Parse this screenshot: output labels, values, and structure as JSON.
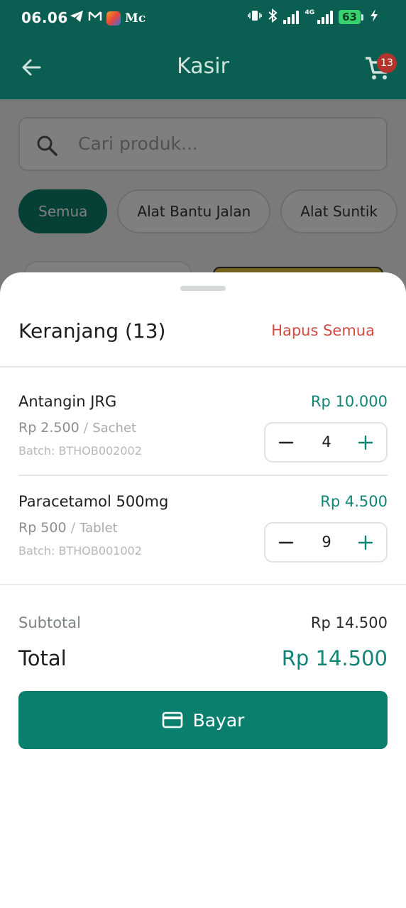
{
  "status_bar": {
    "time": "06.06",
    "notification_text": "Mc",
    "network_type": "4G",
    "battery": "63",
    "icons": [
      "telegram-icon",
      "gmail-icon",
      "app-icon",
      "vibrate-icon",
      "bluetooth-icon",
      "signal-icon",
      "charging-icon"
    ]
  },
  "app_bar": {
    "title": "Kasir",
    "cart_badge": "13"
  },
  "background": {
    "search_placeholder": "Cari produk...",
    "categories": [
      "Semua",
      "Alat Bantu Jalan",
      "Alat Suntik"
    ],
    "active_category": "Semua"
  },
  "cart": {
    "title": "Keranjang (13)",
    "clear_all_label": "Hapus Semua",
    "items": [
      {
        "name": "Antangin JRG",
        "total": "Rp 10.000",
        "unit_price": "Rp 2.500",
        "unit_sep": "/",
        "unit_type": "Sachet",
        "batch": "Batch: BTHOB002002",
        "qty": "4"
      },
      {
        "name": "Paracetamol 500mg",
        "total": "Rp 4.500",
        "unit_price": "Rp 500",
        "unit_sep": "/",
        "unit_type": "Tablet",
        "batch": "Batch: BTHOB001002",
        "qty": "9"
      }
    ],
    "subtotal_label": "Subtotal",
    "subtotal_value": "Rp 14.500",
    "total_label": "Total",
    "total_value": "Rp 14.500",
    "pay_label": "Bayar"
  },
  "colors": {
    "primary": "#0b7f6d",
    "appbar": "#0b5f52",
    "price": "#128476",
    "danger": "#d24a43",
    "badge": "#b3342d"
  }
}
